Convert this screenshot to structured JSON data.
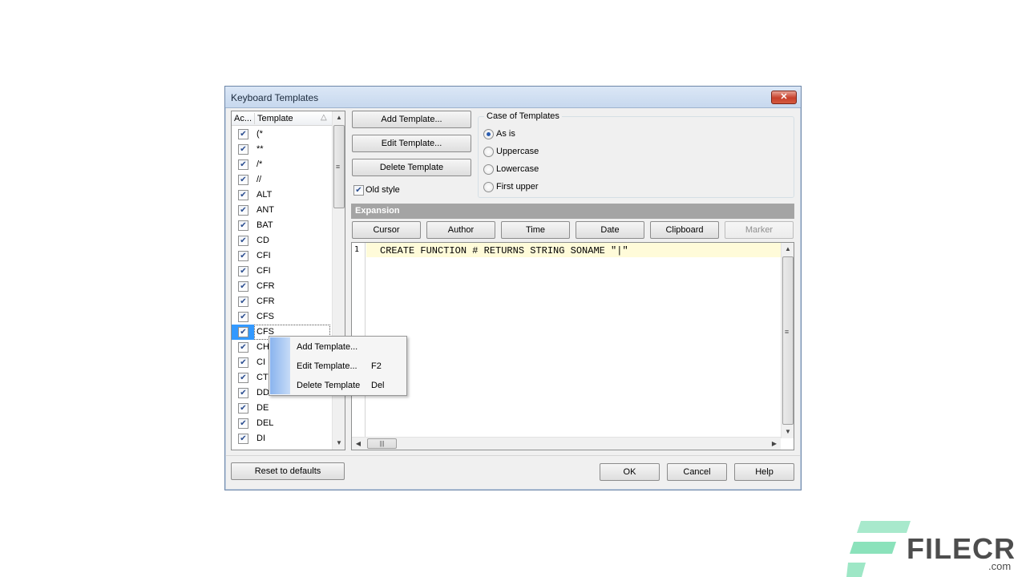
{
  "window": {
    "title": "Keyboard Templates",
    "close_glyph": "✕"
  },
  "list": {
    "columns": [
      "Ac...",
      "Template"
    ],
    "sort_glyph": "△",
    "rows": [
      {
        "checked": true,
        "label": "(*"
      },
      {
        "checked": true,
        "label": "**"
      },
      {
        "checked": true,
        "label": "/*"
      },
      {
        "checked": true,
        "label": "//"
      },
      {
        "checked": true,
        "label": "ALT"
      },
      {
        "checked": true,
        "label": "ANT"
      },
      {
        "checked": true,
        "label": "BAT"
      },
      {
        "checked": true,
        "label": "CD"
      },
      {
        "checked": true,
        "label": "CFI"
      },
      {
        "checked": true,
        "label": "CFI"
      },
      {
        "checked": true,
        "label": "CFR"
      },
      {
        "checked": true,
        "label": "CFR"
      },
      {
        "checked": true,
        "label": "CFS"
      },
      {
        "checked": true,
        "label": "CFS",
        "selected": true
      },
      {
        "checked": true,
        "label": "CH"
      },
      {
        "checked": true,
        "label": "CI"
      },
      {
        "checked": true,
        "label": "CT"
      },
      {
        "checked": true,
        "label": "DD"
      },
      {
        "checked": true,
        "label": "DE"
      },
      {
        "checked": true,
        "label": "DEL"
      },
      {
        "checked": true,
        "label": "DI"
      }
    ]
  },
  "buttons": {
    "add_template": "Add Template...",
    "edit_template": "Edit Template...",
    "delete_template": "Delete Template",
    "reset_defaults": "Reset to defaults",
    "ok": "OK",
    "cancel": "Cancel",
    "help": "Help"
  },
  "old_style": {
    "label": "Old style",
    "checked": true
  },
  "case_group": {
    "title": "Case of Templates",
    "options": [
      "As is",
      "Uppercase",
      "Lowercase",
      "First upper"
    ],
    "selected": "As is"
  },
  "expansion": {
    "label": "Expansion",
    "buttons": [
      "Cursor",
      "Author",
      "Time",
      "Date",
      "Clipboard",
      "Marker"
    ],
    "disabled": [
      "Marker"
    ]
  },
  "editor": {
    "line_number": "1",
    "code": "CREATE FUNCTION # RETURNS STRING SONAME \"|\""
  },
  "context_menu": {
    "items": [
      {
        "label": "Add Template...",
        "shortcut": ""
      },
      {
        "label": "Edit Template...",
        "shortcut": "F2"
      },
      {
        "label": "Delete Template",
        "shortcut": "Del"
      }
    ]
  },
  "watermark": {
    "brand": "FILECR",
    "suffix": ".com"
  },
  "colors": {
    "selection": "#3399ff",
    "expansion_bar": "#a4a4a4",
    "code_highlight": "#fffbd9",
    "watermark_green": "#3ecf8e"
  }
}
